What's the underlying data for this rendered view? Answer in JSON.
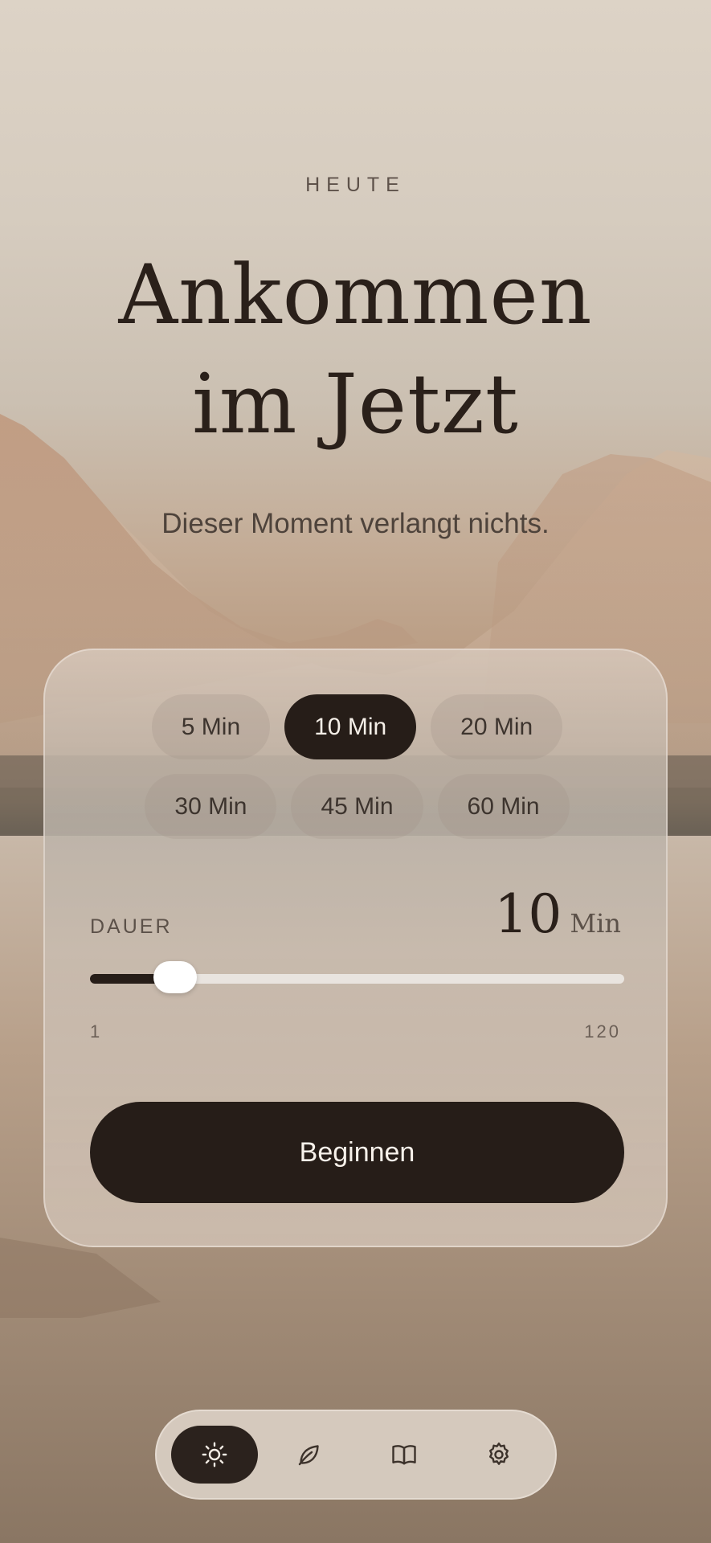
{
  "header": {
    "eyebrow": "HEUTE",
    "title_line1": "Ankommen",
    "title_line2": "im Jetzt",
    "subtitle": "Dieser Moment verlangt nichts."
  },
  "durations": {
    "row1": [
      {
        "label": "5 Min",
        "selected": false
      },
      {
        "label": "10 Min",
        "selected": true
      },
      {
        "label": "20 Min",
        "selected": false
      }
    ],
    "row2": [
      {
        "label": "30 Min",
        "selected": false
      },
      {
        "label": "45 Min",
        "selected": false
      },
      {
        "label": "60 Min",
        "selected": false
      }
    ]
  },
  "dauer": {
    "label": "DAUER",
    "value": "10",
    "unit": "Min",
    "slider_value": 10,
    "slider_min": 1,
    "slider_max": 120,
    "min_label": "1",
    "max_label": "120"
  },
  "action": {
    "begin_label": "Beginnen"
  },
  "tabbar": {
    "tabs": [
      {
        "icon": "sun-icon",
        "active": true
      },
      {
        "icon": "leaf-icon",
        "active": false
      },
      {
        "icon": "book-icon",
        "active": false
      },
      {
        "icon": "gear-icon",
        "active": false
      }
    ]
  },
  "colors": {
    "accent_dark": "#261d18",
    "text_primary": "#2a201a",
    "text_secondary": "#5c5149"
  }
}
